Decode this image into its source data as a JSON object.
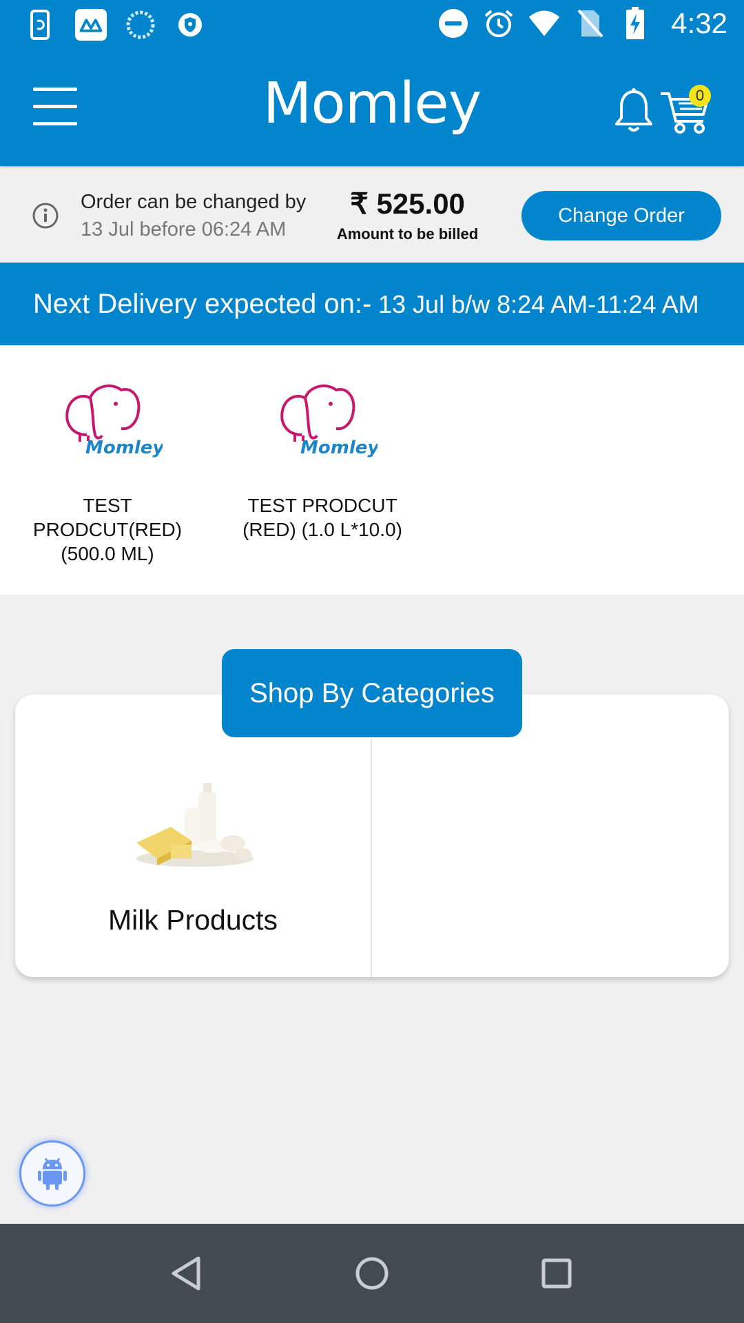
{
  "status_bar": {
    "time": "4:32",
    "left_icons": [
      "phone-sync-icon",
      "app-m-icon",
      "loading-icon",
      "vpn-shield-icon"
    ],
    "right_icons": [
      "do-not-disturb-icon",
      "alarm-icon",
      "wifi-icon",
      "no-sim-icon",
      "battery-charging-icon"
    ]
  },
  "header": {
    "brand": "Momley",
    "cart_count": "0"
  },
  "order": {
    "change_by_label": "Order can be changed by",
    "change_deadline": "13 Jul before 06:24 AM",
    "amount": "₹ 525.00",
    "amount_label": "Amount to be billed",
    "change_button": "Change Order"
  },
  "delivery": {
    "label": "Next Delivery expected on:-",
    "date_window": "13 Jul  b/w 8:24 AM-11:24 AM"
  },
  "products": [
    {
      "name": "TEST PRODCUT(RED) (500.0 ML)",
      "logo_text": "Momley"
    },
    {
      "name": "TEST PRODCUT (RED) (1.0 L*10.0)",
      "logo_text": "Momley"
    }
  ],
  "categories": {
    "header": "Shop By Categories",
    "items": [
      {
        "name": "Milk Products",
        "icon": "dairy-products-image"
      }
    ]
  },
  "colors": {
    "primary": "#0385cd",
    "badge": "#f5e31a",
    "logo_pink": "#c8176c",
    "logo_blue": "#1d86c9",
    "nav_bg": "#434a50"
  }
}
